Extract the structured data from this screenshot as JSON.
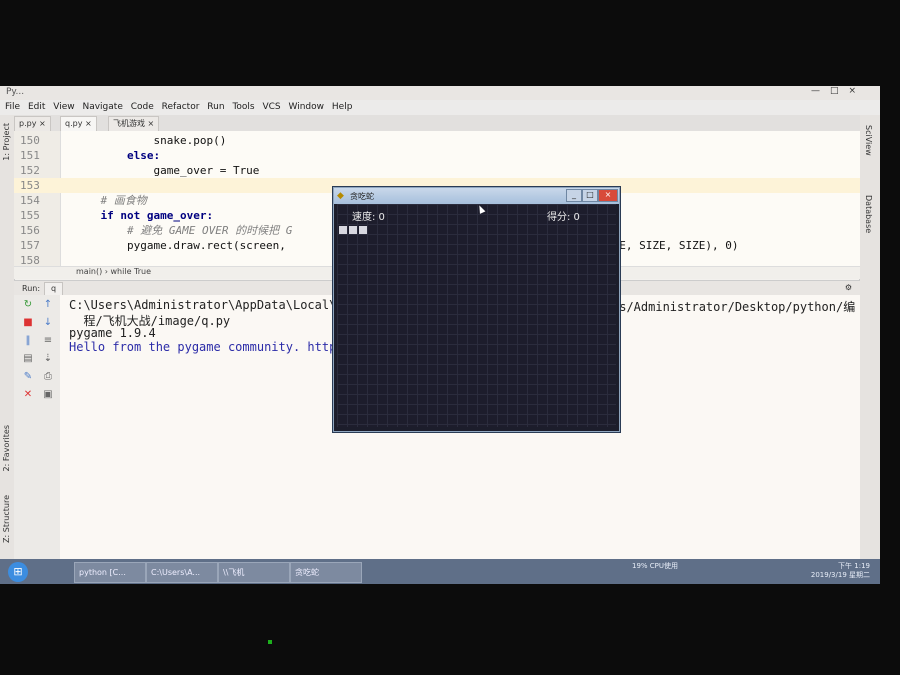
{
  "ide": {
    "window_title": "Py...",
    "window_controls": "—□×",
    "menu": [
      "File",
      "Edit",
      "View",
      "Navigate",
      "Code",
      "Refactor",
      "Run",
      "Tools",
      "VCS",
      "Window",
      "Help"
    ],
    "tabs": [
      {
        "label": "p.py ×"
      },
      {
        "label": "q.py ×"
      },
      {
        "label": "飞机游戏 ×"
      }
    ],
    "left_tools": {
      "project": "1: Project",
      "favorites": "2: Favorites",
      "structure": "Z: Structure"
    },
    "right_tools": {
      "sciview": "SciView",
      "database": "Database"
    },
    "code_lines": [
      {
        "num": "150",
        "text": "            snake.pop()"
      },
      {
        "num": "151",
        "text": "        else:"
      },
      {
        "num": "152",
        "text": "            game_over = True"
      },
      {
        "num": "153",
        "text": ""
      },
      {
        "num": "154",
        "text": "    # 画食物"
      },
      {
        "num": "155",
        "text": "    if not game_over:"
      },
      {
        "num": "156",
        "text": "        # 避免 GAME OVER 的时候把 G"
      },
      {
        "num": "157",
        "text": "        pygame.draw.rect(screen,"
      },
      {
        "num": "158",
        "text": ""
      }
    ],
    "code_tail": "IZE, SIZE, SIZE), 0)",
    "breadcrumb": "main()  ›  while True",
    "run": {
      "label": "Run:",
      "tab": "q",
      "console": [
        "C:\\Users\\Administrator\\AppData\\Local\\P",
        "  程/飞机大战/image/q.py",
        "pygame 1.9.4",
        "Hello from the pygame community. https"
      ],
      "console_right": "rs/Administrator/Desktop/python/编"
    }
  },
  "game_window": {
    "title": "贪吃蛇",
    "speed_label": "速度: 0",
    "score_label": "得分: 0",
    "controls": [
      "_",
      "□",
      "×"
    ]
  },
  "taskbar": {
    "items": [
      "python [C...",
      "C:\\Users\\A...",
      "\\\\飞机",
      "贪吃蛇"
    ],
    "cpu": "19%\nCPU使用",
    "time": "下午 1:19",
    "date": "2019/3/19 星期二"
  },
  "colors": {
    "accent": "#3c8de0",
    "game_bg": "#1c1d2b"
  }
}
